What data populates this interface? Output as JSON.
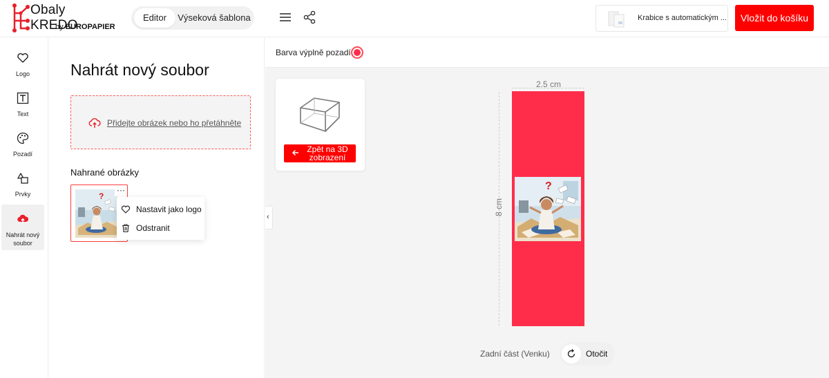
{
  "header": {
    "logo_title": "Obaly KREDO",
    "logo_by": "by",
    "logo_company": "EUROPAPIER",
    "mode_tabs": [
      {
        "label": "Editor",
        "active": true
      },
      {
        "label": "Výseková šablona",
        "active": false
      }
    ],
    "product_name": "Krabice s automatickým ...",
    "cart_label": "Vložit do košíku"
  },
  "rail": {
    "items": [
      {
        "label": "Logo",
        "icon": "heart-icon",
        "active": false
      },
      {
        "label": "Text",
        "icon": "text-icon",
        "active": false
      },
      {
        "label": "Pozadí",
        "icon": "palette-icon",
        "active": false
      },
      {
        "label": "Prvky",
        "icon": "shapes-icon",
        "active": false
      },
      {
        "label": "Nahrát nový soubor",
        "icon": "upload-cloud-icon",
        "active": true
      }
    ]
  },
  "panel": {
    "title": "Nahrát nový soubor",
    "dropzone_text": "Přidejte obrázek nebo ho přetáhněte",
    "uploaded_label": "Nahrané obrázky",
    "thumb_menu": "···",
    "context_menu": [
      {
        "label": "Nastavit jako logo",
        "icon": "heart-icon"
      },
      {
        "label": "Odstranit",
        "icon": "trash-icon"
      }
    ]
  },
  "canvas": {
    "fill_label": "Barva výplně pozadí",
    "fill_color": "#ff2d4a",
    "back_3d_label": "Zpět na 3D zobrazení",
    "collapse_glyph": "‹",
    "width_label": "2.5 cm",
    "height_label": "8 cm",
    "side_label": "Zadní část (Venku)",
    "rotate_label": "Otočit"
  },
  "colors": {
    "accent": "#ff0000",
    "box_face": "#ff2d4a"
  }
}
